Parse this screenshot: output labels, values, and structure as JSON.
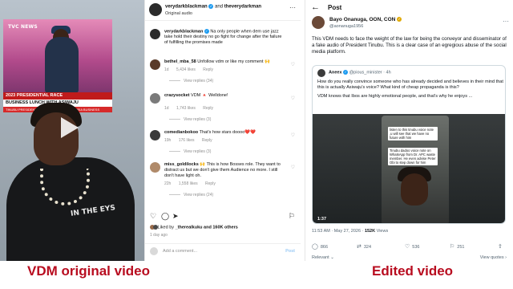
{
  "left_video": {
    "tv_logo": "TVC NEWS",
    "lower_third_1": "2023 PRESIDENTIAL RACE",
    "lower_third_2": "BUSINESS LUNCH WITH ASIWAJU",
    "lower_third_3": "TINUBU PRESIDENT WILL BE GOOD FOR NIGERIA BUSINESS",
    "shirt_text": "IN THE EYS"
  },
  "comments_panel": {
    "header": {
      "handle_1": "verydarkblackman",
      "and": "and",
      "handle_2": "theverydarkman",
      "subtitle": "Original audio"
    },
    "comments": [
      {
        "user": "verydarkblackman",
        "text": "Na only people when dem use jazz take hold their destiny no go fight for change after the failure of fulfilling the promises made",
        "time": "",
        "likes": "",
        "reply": "",
        "replies": ""
      },
      {
        "user": "bethel_mba_58",
        "text": "Unfollow vdm or like my comment 🙌",
        "time": "1d",
        "likes": "5,434 likes",
        "reply": "Reply",
        "replies": "View replies (34)"
      },
      {
        "user": "crazysocket",
        "text": "VDM 🔺 Welldone!",
        "time": "1d",
        "likes": "1,743 likes",
        "reply": "Reply",
        "replies": "View replies (3)"
      },
      {
        "user": "comedianbokoo",
        "text": "That's how stars doooo❤️❤️",
        "time": "19h",
        "likes": "176 likes",
        "reply": "Reply",
        "replies": "View replies (3)"
      },
      {
        "user": "miss_goldilocks",
        "text": "🙌 This is how Bosses role. They want to distract us but we don't give them Audience no more. I still don't have light oh.",
        "time": "22h",
        "likes": "1,558 likes",
        "reply": "Reply",
        "replies": "View replies (24)"
      }
    ],
    "liked_by_prefix": "Liked by",
    "liked_by_user": "_therealkuku",
    "liked_by_suffix": "and 160K others",
    "ago": "1 day ago",
    "add_comment_placeholder": "Add a comment...",
    "post_label": "Post"
  },
  "x_post": {
    "title": "Post",
    "author_name": "Bayo Onanuga, OON, CON",
    "author_handle": "@aonanuga1956",
    "text": "This VDM needs to face the weight of the law for  being the conveyor and disseminator of a fake audio of President Tinubu. This is a clear case of an egregious abuse of the social media platform.",
    "quote": {
      "author_name": "Aneex",
      "author_handle": "@pious_minister",
      "time": "4h",
      "paragraph_1": "How do you really convince someone who has already decided and believes in their mind that this is actually Asiwaju's voice? What kind of cheap propaganda is this?",
      "paragraph_2": "VDM knows that Ibos are highly emotional people, and that's why he enjoys ...",
      "caption_1": "listen to this tinubu voice note ,u will see that we have no future with him",
      "caption_2": "Tinubu dadoo voice note on WhatsApp from Dr. APC waste member. He even advise Peter Obi to step down for him",
      "video_time": "1:37"
    },
    "meta_time": "11:53 AM · May 27, 2026 ·",
    "meta_views": "152K",
    "meta_views_label": "Views",
    "stats": {
      "replies": "866",
      "reposts": "324",
      "likes": "536",
      "bookmarks": "251"
    },
    "relevant": "Relevant",
    "view_quotes": "View quotes"
  },
  "captions": {
    "left": "VDM original video",
    "right": "Edited video"
  },
  "colors": {
    "caption": "#b80c1f",
    "verified": "#1d9bf0",
    "banner_red": "#c01b1b"
  }
}
